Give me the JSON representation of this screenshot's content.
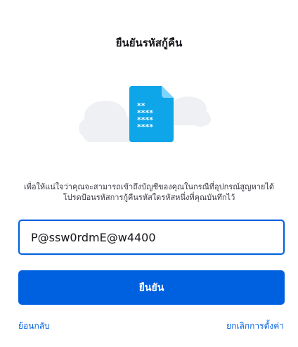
{
  "dialog": {
    "title": "ยืนยันรหัสกู้คืน",
    "description": "เพื่อให้แน่ใจว่าคุณจะสามารถเข้าถึงบัญชีของคุณในกรณีที่อุปกรณ์สูญหายได้โปรดป้อนรหัสการกู้คืนรหัสใดรหัสหนึ่งที่คุณบันทึกไว้",
    "code_input_value": "P@ssw0rdmE@w4400",
    "confirm_label": "ยืนยัน",
    "back_label": "ย้อนกลับ",
    "cancel_label": "ยกเลิกการตั้งค่า"
  },
  "illustration": {
    "icon": "password-document-icon",
    "document_color": "#0ea5e9",
    "document_color_dark": "#0284c7",
    "cloud_color": "#eef0f3"
  },
  "colors": {
    "accent": "#0061e0",
    "title_text": "#15141a",
    "body_text": "#3a3944"
  }
}
